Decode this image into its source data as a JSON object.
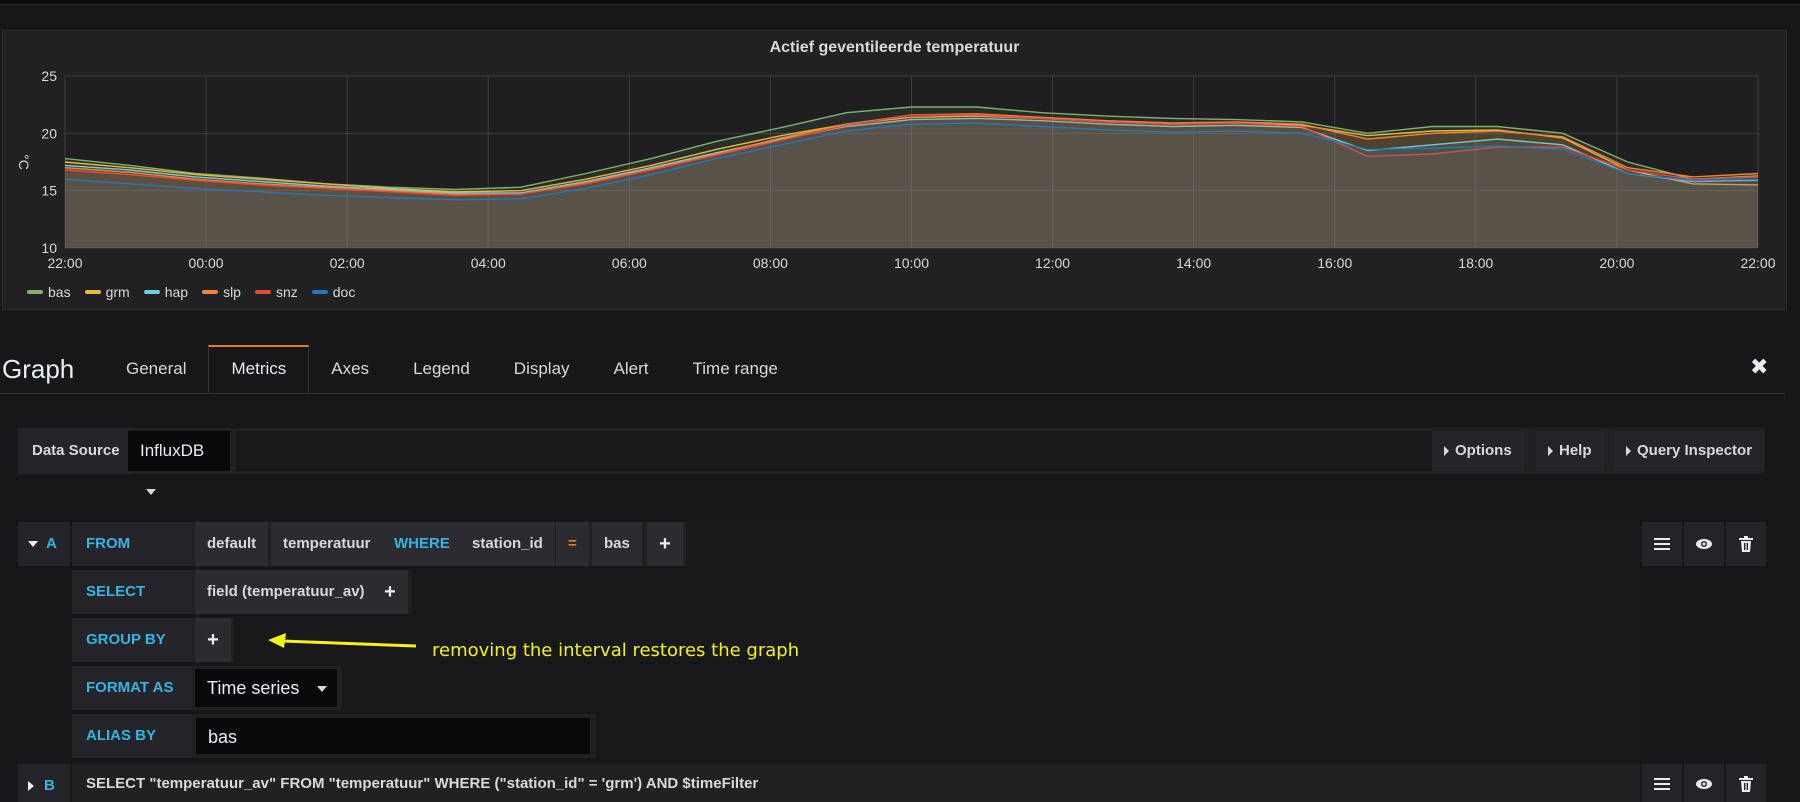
{
  "panel": {
    "title": "Actief geventileerde temperatuur"
  },
  "chart_data": {
    "type": "line",
    "title": "Actief geventileerde temperatuur",
    "ylabel": "°C",
    "xlabel": "",
    "ylim": [
      10,
      25
    ],
    "yticks": [
      "10",
      "15",
      "20",
      "25"
    ],
    "xticks": [
      "22:00",
      "00:00",
      "02:00",
      "04:00",
      "06:00",
      "08:00",
      "10:00",
      "12:00",
      "14:00",
      "16:00",
      "18:00",
      "20:00",
      "22:00"
    ],
    "grid": true,
    "legend_position": "bottom-left",
    "series": [
      {
        "name": "bas",
        "color": "#7eb26d",
        "values": [
          17.8,
          17.2,
          16.5,
          16.1,
          15.6,
          15.3,
          15.1,
          15.3,
          16.5,
          17.8,
          19.3,
          20.5,
          21.8,
          22.3,
          22.3,
          21.8,
          21.5,
          21.3,
          21.2,
          21.0,
          20.0,
          20.6,
          20.6,
          20.0,
          17.5,
          16.0,
          16.3
        ]
      },
      {
        "name": "grm",
        "color": "#eab839",
        "values": [
          17.5,
          17.0,
          16.4,
          16.0,
          15.6,
          15.2,
          14.9,
          15.0,
          16.0,
          17.2,
          18.6,
          19.8,
          20.8,
          21.4,
          21.5,
          21.3,
          21.0,
          20.8,
          20.9,
          20.7,
          19.8,
          20.2,
          20.3,
          19.6,
          16.8,
          15.6,
          15.5
        ]
      },
      {
        "name": "hap",
        "color": "#6ed0e0",
        "values": [
          17.2,
          16.8,
          16.2,
          15.8,
          15.4,
          15.1,
          14.8,
          14.8,
          15.8,
          17.0,
          18.3,
          19.5,
          20.6,
          21.2,
          21.3,
          21.1,
          20.8,
          20.6,
          20.7,
          20.5,
          18.5,
          19.0,
          19.5,
          19.0,
          16.5,
          15.8,
          15.9
        ]
      },
      {
        "name": "slp",
        "color": "#ef843c",
        "values": [
          17.0,
          16.6,
          16.0,
          15.6,
          15.3,
          15.0,
          14.7,
          14.7,
          15.7,
          16.9,
          18.2,
          19.6,
          20.8,
          21.6,
          21.7,
          21.4,
          21.1,
          20.9,
          21.0,
          20.8,
          19.5,
          20.0,
          20.2,
          19.7,
          17.0,
          16.2,
          16.5
        ]
      },
      {
        "name": "snz",
        "color": "#e24d42",
        "values": [
          16.8,
          16.4,
          15.9,
          15.5,
          15.2,
          14.9,
          14.6,
          14.7,
          15.6,
          16.8,
          18.1,
          19.4,
          20.7,
          21.6,
          21.6,
          21.3,
          21.0,
          20.8,
          20.9,
          20.6,
          18.0,
          18.2,
          18.8,
          18.8,
          16.8,
          16.0,
          16.2
        ]
      },
      {
        "name": "doc",
        "color": "#1f78c1",
        "values": [
          16.0,
          15.6,
          15.2,
          14.9,
          14.6,
          14.4,
          14.2,
          14.3,
          15.2,
          16.4,
          17.8,
          19.0,
          20.2,
          20.8,
          20.9,
          20.6,
          20.3,
          20.1,
          20.2,
          20.0,
          18.6,
          18.7,
          18.9,
          18.6,
          16.5,
          15.9,
          16.0
        ]
      }
    ]
  },
  "editor": {
    "title": "Graph",
    "tabs": [
      "General",
      "Metrics",
      "Axes",
      "Legend",
      "Display",
      "Alert",
      "Time range"
    ],
    "active_tab": "Metrics"
  },
  "datasource": {
    "label": "Data Source",
    "value": "InfluxDB",
    "options_label": "Options",
    "help_label": "Help",
    "inspector_label": "Query Inspector"
  },
  "queryA": {
    "ref": "A",
    "from_kw": "FROM",
    "policy": "default",
    "measurement": "temperatuur",
    "where_kw": "WHERE",
    "tag_key": "station_id",
    "operator": "=",
    "tag_value": "bas",
    "select_kw": "SELECT",
    "field": "field (temperatuur_av)",
    "group_kw": "GROUP BY",
    "format_kw": "FORMAT AS",
    "format_value": "Time series",
    "alias_kw": "ALIAS BY",
    "alias_value": "bas",
    "plus": "+"
  },
  "queryB": {
    "ref": "B",
    "raw": "SELECT \"temperatuur_av\" FROM \"temperatuur\" WHERE (\"station_id\" = 'grm') AND $timeFilter"
  },
  "annotation": {
    "text": "removing the interval restores the graph",
    "color": "#f3f31a"
  },
  "close": "✖"
}
